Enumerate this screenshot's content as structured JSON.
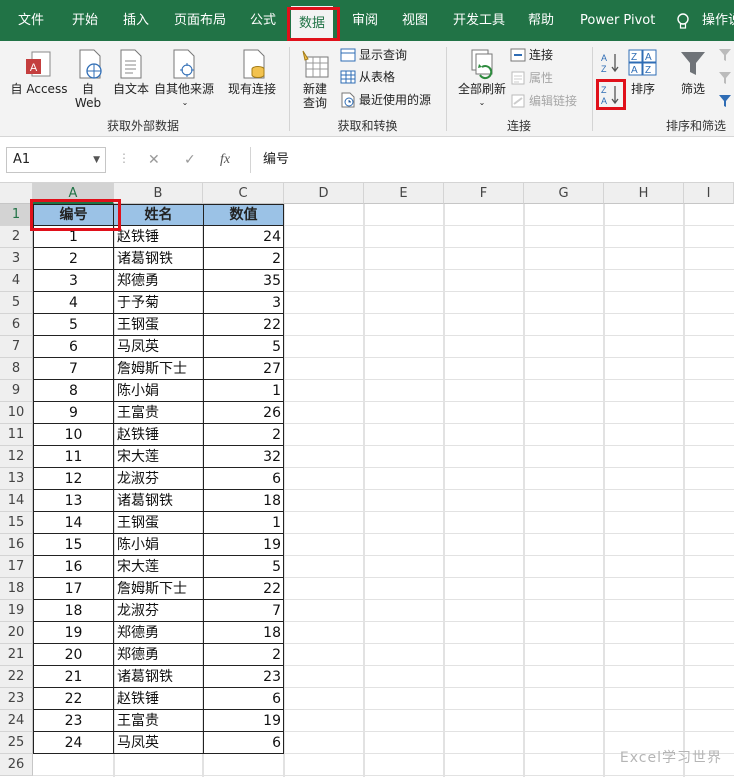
{
  "tabs": [
    {
      "label": "文件",
      "active": false
    },
    {
      "label": "开始",
      "active": false
    },
    {
      "label": "插入",
      "active": false
    },
    {
      "label": "页面布局",
      "active": false
    },
    {
      "label": "公式",
      "active": false
    },
    {
      "label": "数据",
      "active": true
    },
    {
      "label": "审阅",
      "active": false
    },
    {
      "label": "视图",
      "active": false
    },
    {
      "label": "开发工具",
      "active": false
    },
    {
      "label": "帮助",
      "active": false
    },
    {
      "label": "Power Pivot",
      "active": false
    }
  ],
  "tellme_label": "操作说",
  "ribbon": {
    "external": {
      "access": "自 Access",
      "web": "自\nWeb",
      "text": "自文本",
      "other": "自其他来源",
      "existing": "现有连接",
      "group": "获取外部数据"
    },
    "transform": {
      "new_query": "新建\n查询",
      "show_queries": "显示查询",
      "from_table": "从表格",
      "recent": "最近使用的源",
      "group": "获取和转换"
    },
    "connections": {
      "refresh_all": "全部刷新",
      "connections": "连接",
      "properties": "属性",
      "edit_links": "编辑链接",
      "group": "连接"
    },
    "sort": {
      "sort": "排序",
      "filter": "筛选",
      "group": "排序和筛选"
    }
  },
  "formula_bar": {
    "name_box": "A1",
    "formula": "编号",
    "fx": "fx"
  },
  "columns": [
    "A",
    "B",
    "C",
    "D",
    "E",
    "F",
    "G",
    "H",
    "I"
  ],
  "rows": [
    "1",
    "2",
    "3",
    "4",
    "5",
    "6",
    "7",
    "8",
    "9",
    "10",
    "11",
    "12",
    "13",
    "14",
    "15",
    "16",
    "17",
    "18",
    "19",
    "20",
    "21",
    "22",
    "23",
    "24",
    "25",
    "26"
  ],
  "table": {
    "headers": [
      "编号",
      "姓名",
      "数值"
    ],
    "rows": [
      [
        "1",
        "赵铁锤",
        "24"
      ],
      [
        "2",
        "诸葛钢铁",
        "2"
      ],
      [
        "3",
        "郑德勇",
        "35"
      ],
      [
        "4",
        "于予菊",
        "3"
      ],
      [
        "5",
        "王钢蛋",
        "22"
      ],
      [
        "6",
        "马凤英",
        "5"
      ],
      [
        "7",
        "詹姆斯下士",
        "27"
      ],
      [
        "8",
        "陈小娟",
        "1"
      ],
      [
        "9",
        "王富贵",
        "26"
      ],
      [
        "10",
        "赵铁锤",
        "2"
      ],
      [
        "11",
        "宋大莲",
        "32"
      ],
      [
        "12",
        "龙淑芬",
        "6"
      ],
      [
        "13",
        "诸葛钢铁",
        "18"
      ],
      [
        "14",
        "王钢蛋",
        "1"
      ],
      [
        "15",
        "陈小娟",
        "19"
      ],
      [
        "16",
        "宋大莲",
        "5"
      ],
      [
        "17",
        "詹姆斯下士",
        "22"
      ],
      [
        "18",
        "龙淑芬",
        "7"
      ],
      [
        "19",
        "郑德勇",
        "18"
      ],
      [
        "20",
        "郑德勇",
        "2"
      ],
      [
        "21",
        "诸葛钢铁",
        "23"
      ],
      [
        "22",
        "赵铁锤",
        "6"
      ],
      [
        "23",
        "王富贵",
        "19"
      ],
      [
        "24",
        "马凤英",
        "6"
      ]
    ]
  },
  "watermark": "Excel学习世界",
  "colors": {
    "excel_green": "#217346",
    "header_fill": "#9bc2e6",
    "highlight": "#e0101a"
  }
}
